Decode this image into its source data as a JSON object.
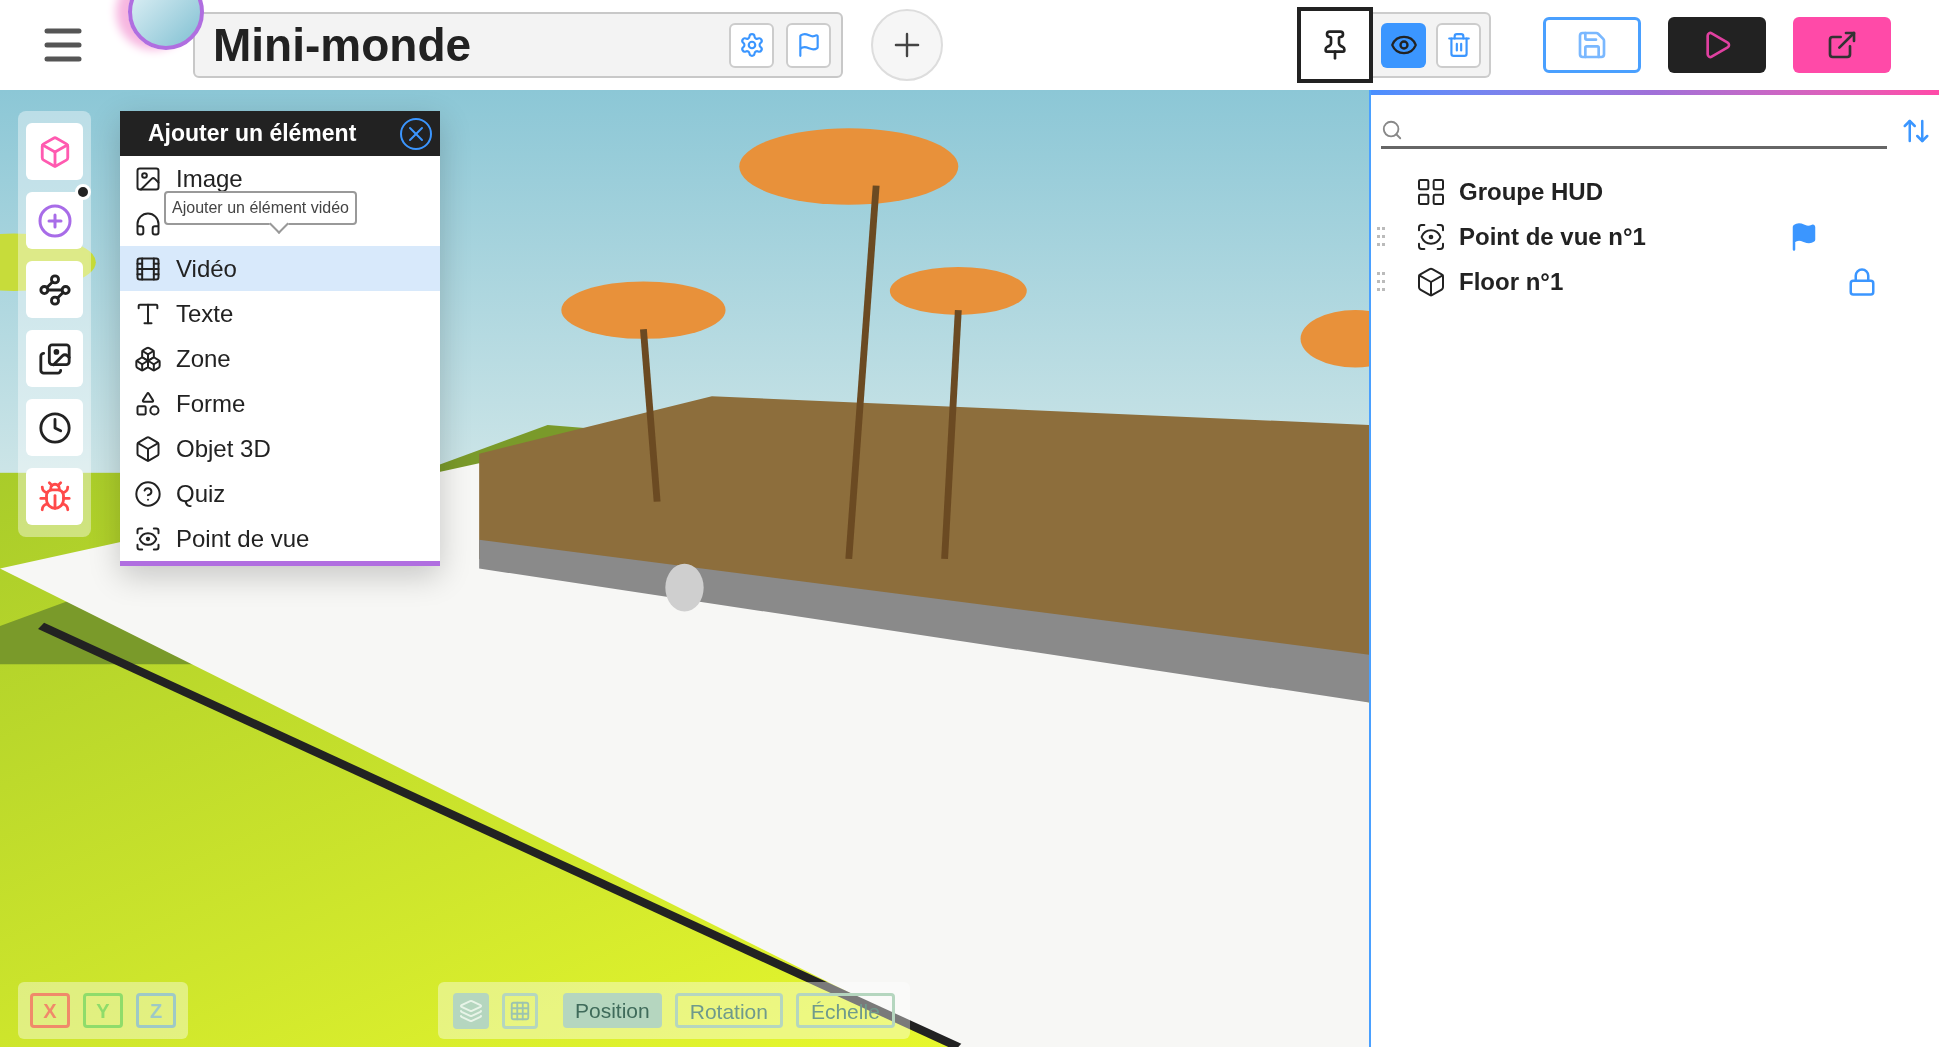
{
  "header": {
    "title": "Mini-monde",
    "pin_selected": true,
    "preview_on": true
  },
  "add_menu": {
    "title": "Ajouter un élément",
    "tooltip": "Ajouter un élément vidéo",
    "items": [
      {
        "kind": "image",
        "label": "Image",
        "selected": false
      },
      {
        "kind": "sound",
        "selected": false
      },
      {
        "kind": "video",
        "label": "Vidéo",
        "selected": true
      },
      {
        "kind": "text",
        "label": "Texte",
        "selected": false
      },
      {
        "kind": "zone",
        "label": "Zone",
        "selected": false
      },
      {
        "kind": "shape",
        "label": "Forme",
        "selected": false
      },
      {
        "kind": "object3d",
        "label": "Objet 3D",
        "selected": false
      },
      {
        "kind": "quiz",
        "label": "Quiz",
        "selected": false
      },
      {
        "kind": "viewpoint",
        "label": "Point de vue",
        "selected": false
      }
    ]
  },
  "outline": {
    "items": [
      {
        "kind": "group",
        "label": "Groupe HUD",
        "draggable": false,
        "flagged": false,
        "locked": false
      },
      {
        "kind": "viewpoint",
        "label": "Point de vue n°1",
        "draggable": true,
        "flagged": true,
        "locked": false
      },
      {
        "kind": "object3d",
        "label": "Floor n°1",
        "draggable": true,
        "flagged": false,
        "locked": true
      }
    ]
  },
  "axes": [
    {
      "label": "X",
      "color": "#f08a6a"
    },
    {
      "label": "Y",
      "color": "#8fdc6a"
    },
    {
      "label": "Z",
      "color": "#9ec9c6"
    }
  ],
  "transform_modes": [
    {
      "label": "Position",
      "selected": true
    },
    {
      "label": "Rotation",
      "selected": false
    },
    {
      "label": "Échelle",
      "selected": false
    }
  ]
}
